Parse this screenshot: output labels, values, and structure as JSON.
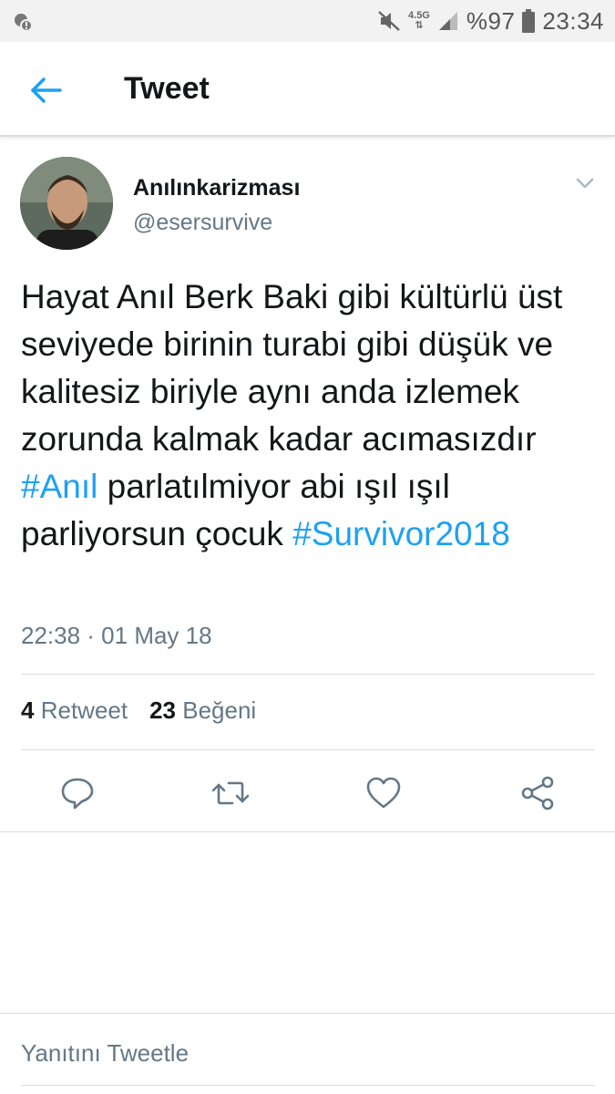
{
  "status_bar": {
    "network": "4.5G",
    "battery": "%97",
    "time": "23:34"
  },
  "header": {
    "title": "Tweet",
    "back_icon": "arrow-left-icon"
  },
  "tweet": {
    "display_name": "Anılınkarizması",
    "handle": "@esersurvive",
    "text_segments": {
      "part1": "Hayat Anıl Berk Baki gibi kültürlü üst seviyede birinin turabi gibi düşük ve kalitesiz biriyle aynı anda izlemek zorunda kalmak kadar acımasızdır ",
      "hashtag1": "#Anıl",
      "part2": " parlatılmiyor abi ışıl ışıl parliyorsun çocuk ",
      "hashtag2": "#Survivor2018"
    },
    "timestamp": "22:38 · 01 May 18",
    "retweet_count": "4",
    "retweet_label": "Retweet",
    "like_count": "23",
    "like_label": "Beğeni"
  },
  "actions": [
    {
      "name": "reply",
      "icon": "reply-icon"
    },
    {
      "name": "retweet",
      "icon": "retweet-icon"
    },
    {
      "name": "like",
      "icon": "heart-icon"
    },
    {
      "name": "share",
      "icon": "share-icon"
    }
  ],
  "reply_box": {
    "placeholder": "Yanıtını Tweetle"
  },
  "colors": {
    "accent": "#1da1f2",
    "secondary_text": "#657786",
    "primary_text": "#14171a"
  }
}
